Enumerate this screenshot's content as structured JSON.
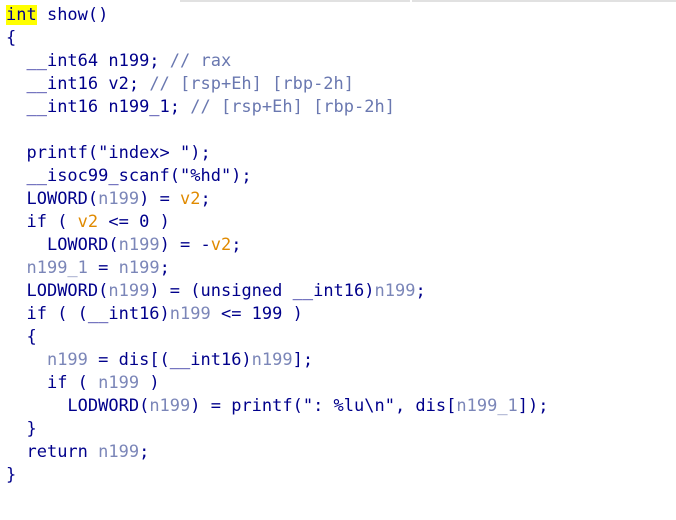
{
  "lines": [
    {
      "indent": "",
      "tokens": [
        {
          "t": "int",
          "c": "hl"
        },
        {
          "t": " show()",
          "c": "plain"
        }
      ]
    },
    {
      "indent": "",
      "tokens": [
        {
          "t": "{",
          "c": "plain"
        }
      ]
    },
    {
      "indent": "  ",
      "tokens": [
        {
          "t": "__int64 n199; ",
          "c": "plain"
        },
        {
          "t": "// rax",
          "c": "cmt"
        }
      ]
    },
    {
      "indent": "  ",
      "tokens": [
        {
          "t": "__int16 v2; ",
          "c": "plain"
        },
        {
          "t": "// [rsp+Eh] [rbp-2h]",
          "c": "cmt"
        }
      ]
    },
    {
      "indent": "  ",
      "tokens": [
        {
          "t": "__int16 n199_1; ",
          "c": "plain"
        },
        {
          "t": "// [rsp+Eh] [rbp-2h]",
          "c": "cmt"
        }
      ]
    },
    {
      "indent": "",
      "tokens": []
    },
    {
      "indent": "  ",
      "tokens": [
        {
          "t": "printf(\"index> \");",
          "c": "plain"
        }
      ]
    },
    {
      "indent": "  ",
      "tokens": [
        {
          "t": "__isoc99_scanf(\"%hd\");",
          "c": "plain"
        }
      ]
    },
    {
      "indent": "  ",
      "tokens": [
        {
          "t": "LOWORD(",
          "c": "plain"
        },
        {
          "t": "n199",
          "c": "var"
        },
        {
          "t": ") = ",
          "c": "plain"
        },
        {
          "t": "v2",
          "c": "orange"
        },
        {
          "t": ";",
          "c": "plain"
        }
      ]
    },
    {
      "indent": "  ",
      "tokens": [
        {
          "t": "if ( ",
          "c": "plain"
        },
        {
          "t": "v2",
          "c": "orange"
        },
        {
          "t": " <= 0 )",
          "c": "plain"
        }
      ]
    },
    {
      "indent": "    ",
      "tokens": [
        {
          "t": "LOWORD(",
          "c": "plain"
        },
        {
          "t": "n199",
          "c": "var"
        },
        {
          "t": ") = -",
          "c": "plain"
        },
        {
          "t": "v2",
          "c": "orange"
        },
        {
          "t": ";",
          "c": "plain"
        }
      ]
    },
    {
      "indent": "  ",
      "tokens": [
        {
          "t": "n199_1",
          "c": "var"
        },
        {
          "t": " = ",
          "c": "plain"
        },
        {
          "t": "n199",
          "c": "var"
        },
        {
          "t": ";",
          "c": "plain"
        }
      ]
    },
    {
      "indent": "  ",
      "tokens": [
        {
          "t": "LODWORD(",
          "c": "plain"
        },
        {
          "t": "n199",
          "c": "var"
        },
        {
          "t": ") = (unsigned __int16)",
          "c": "plain"
        },
        {
          "t": "n199",
          "c": "var"
        },
        {
          "t": ";",
          "c": "plain"
        }
      ]
    },
    {
      "indent": "  ",
      "tokens": [
        {
          "t": "if ( (__int16)",
          "c": "plain"
        },
        {
          "t": "n199",
          "c": "var"
        },
        {
          "t": " <= 199 )",
          "c": "plain"
        }
      ]
    },
    {
      "indent": "  ",
      "tokens": [
        {
          "t": "{",
          "c": "plain"
        }
      ]
    },
    {
      "indent": "    ",
      "tokens": [
        {
          "t": "n199",
          "c": "var"
        },
        {
          "t": " = dis[(__int16)",
          "c": "plain"
        },
        {
          "t": "n199",
          "c": "var"
        },
        {
          "t": "];",
          "c": "plain"
        }
      ]
    },
    {
      "indent": "    ",
      "tokens": [
        {
          "t": "if ( ",
          "c": "plain"
        },
        {
          "t": "n199",
          "c": "var"
        },
        {
          "t": " )",
          "c": "plain"
        }
      ]
    },
    {
      "indent": "      ",
      "tokens": [
        {
          "t": "LODWORD(",
          "c": "plain"
        },
        {
          "t": "n199",
          "c": "var"
        },
        {
          "t": ") = printf(\": %lu\\n\", dis[",
          "c": "plain"
        },
        {
          "t": "n199_1",
          "c": "var"
        },
        {
          "t": "]);",
          "c": "plain"
        }
      ]
    },
    {
      "indent": "  ",
      "tokens": [
        {
          "t": "}",
          "c": "plain"
        }
      ]
    },
    {
      "indent": "  ",
      "tokens": [
        {
          "t": "return ",
          "c": "plain"
        },
        {
          "t": "n199",
          "c": "var"
        },
        {
          "t": ";",
          "c": "plain"
        }
      ]
    },
    {
      "indent": "",
      "tokens": [
        {
          "t": "}",
          "c": "plain"
        }
      ]
    }
  ]
}
